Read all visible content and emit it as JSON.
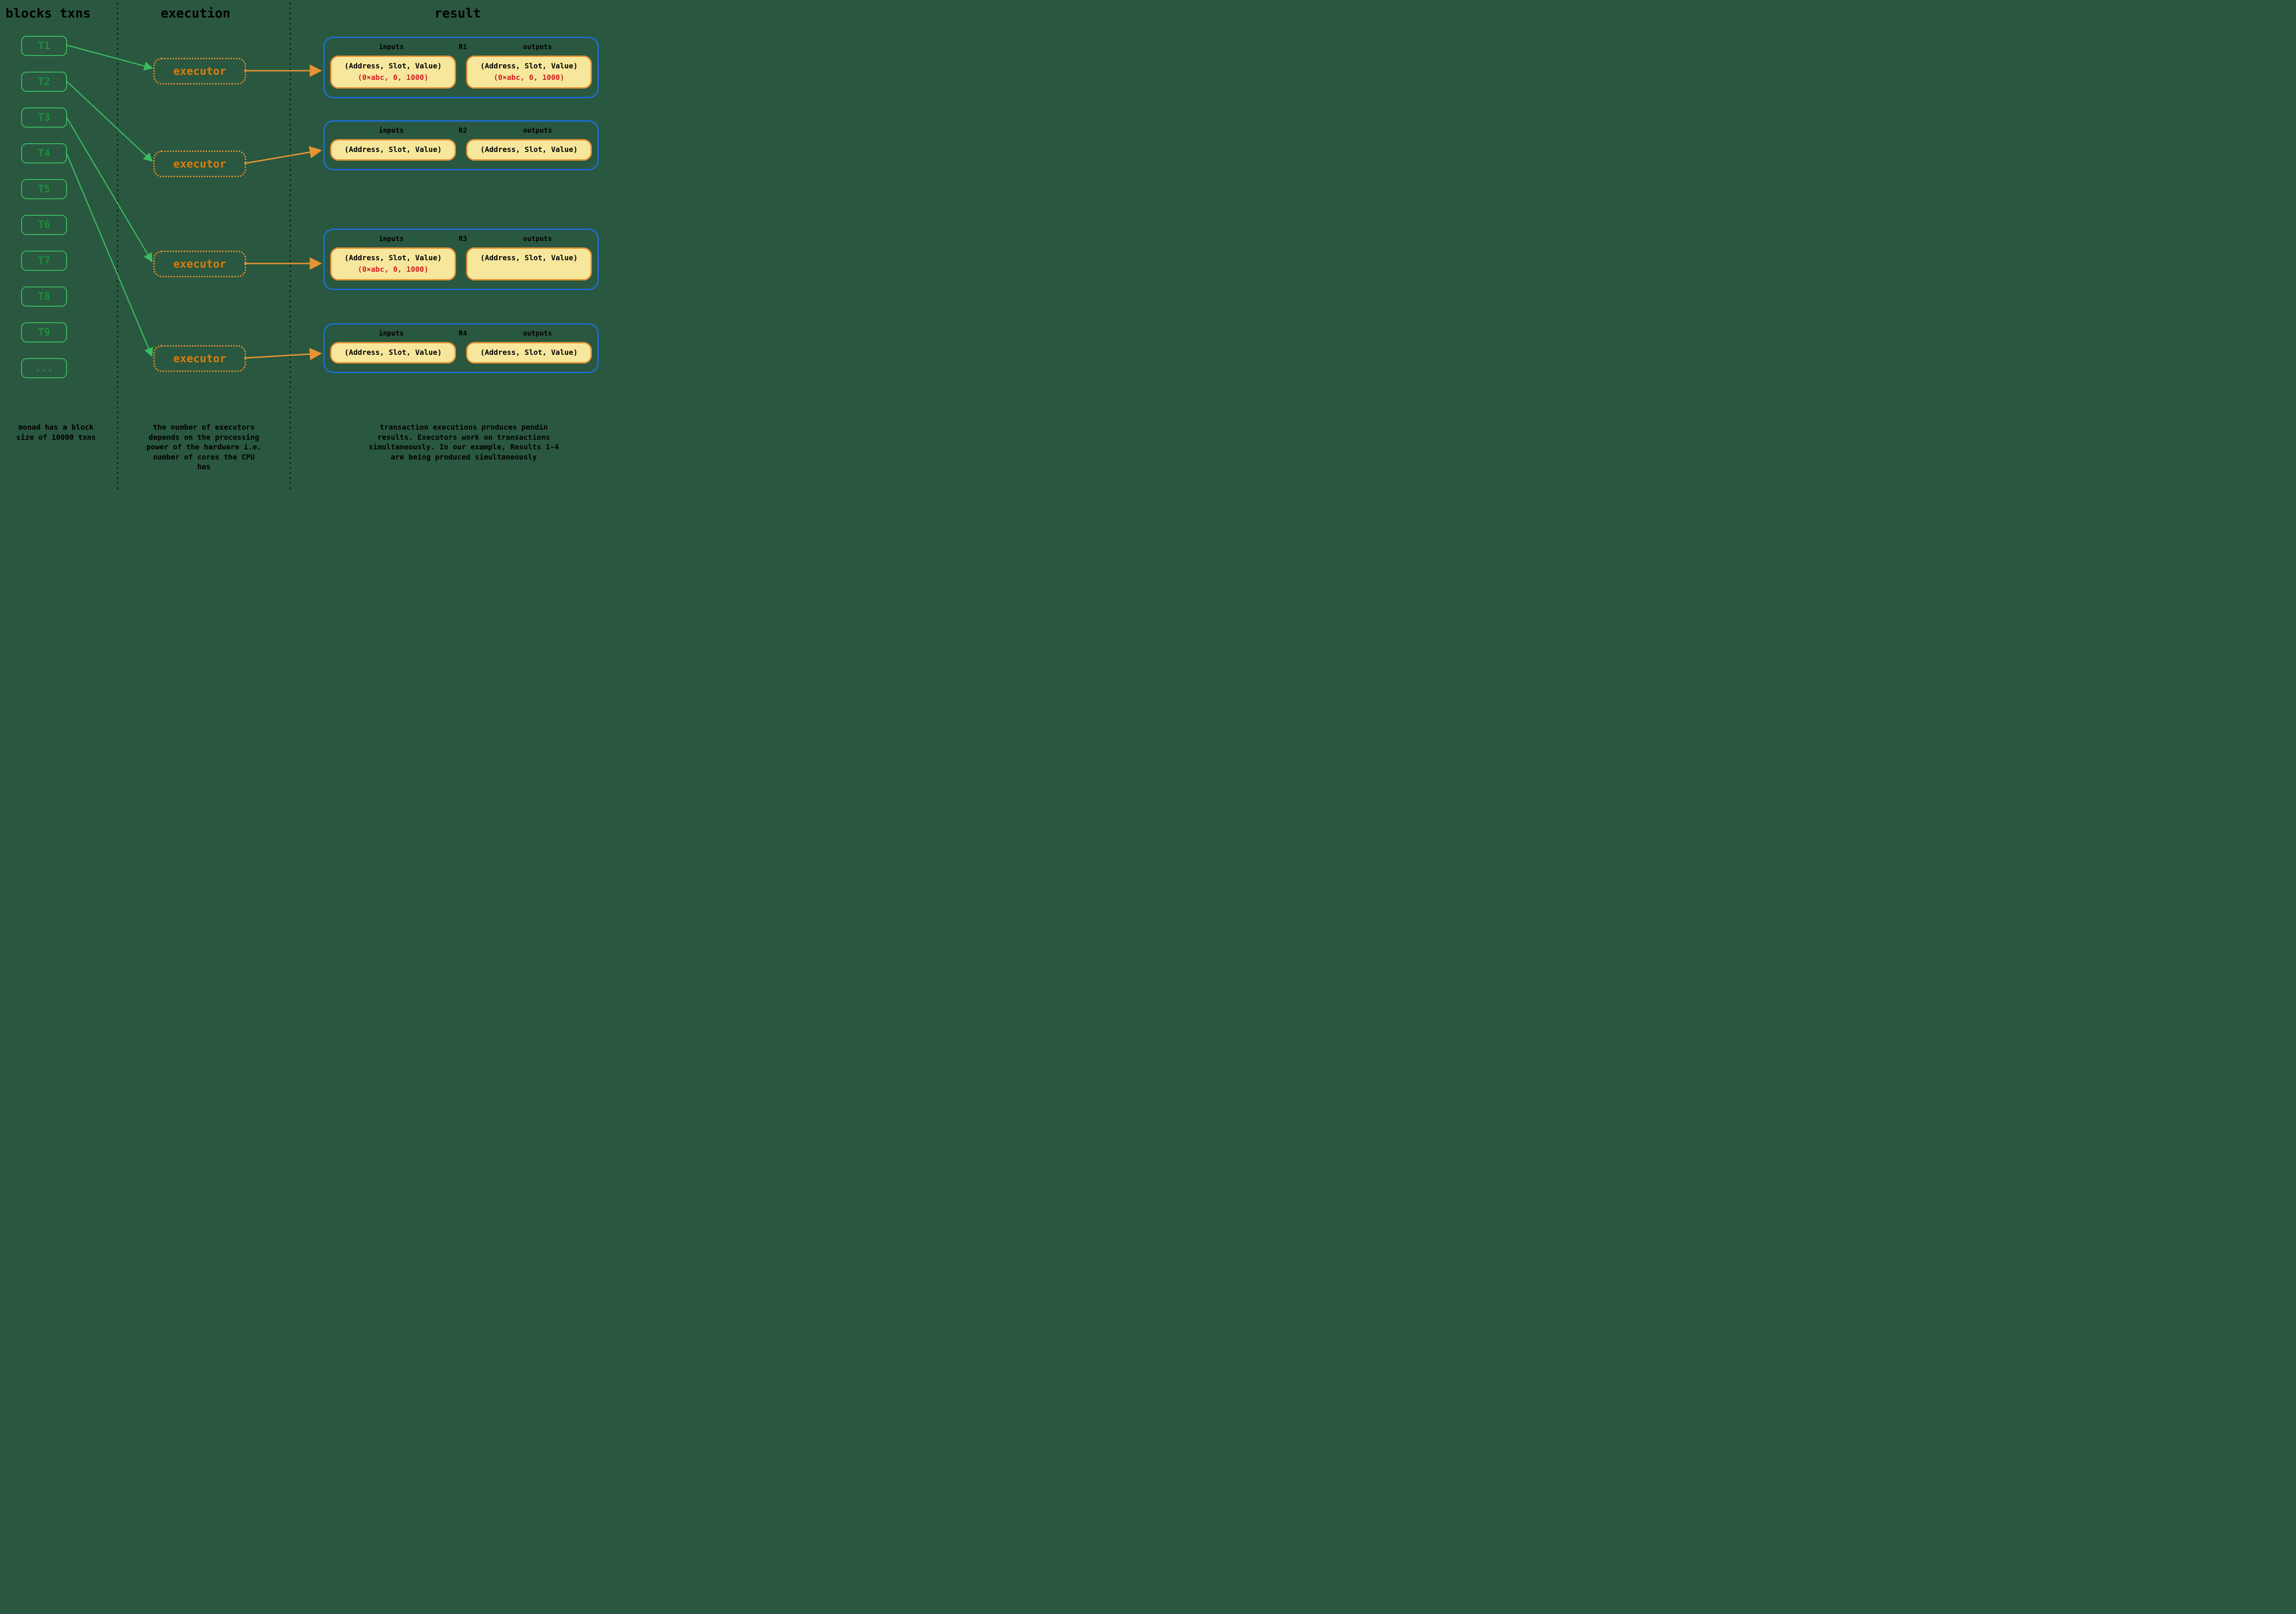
{
  "headers": {
    "col1": "blocks txns",
    "col2": "execution",
    "col3": "result"
  },
  "txns": [
    "T1",
    "T2",
    "T3",
    "T4",
    "T5",
    "T6",
    "T7",
    "T8",
    "T9",
    "..."
  ],
  "executor_label": "executor",
  "results": [
    {
      "id": "R1",
      "inputs_label": "inputs",
      "outputs_label": "outputs",
      "input_tuple": "(Address, Slot, Value)",
      "output_tuple": "(Address, Slot, Value)",
      "input_example": "(0×abc, 0, 1000)",
      "output_example": "(0×abc, 0, 1000)"
    },
    {
      "id": "R2",
      "inputs_label": "inputs",
      "outputs_label": "outputs",
      "input_tuple": "(Address, Slot, Value)",
      "output_tuple": "(Address, Slot, Value)"
    },
    {
      "id": "R3",
      "inputs_label": "inputs",
      "outputs_label": "outputs",
      "input_tuple": "(Address, Slot, Value)",
      "output_tuple": "(Address, Slot, Value)",
      "input_example": "(0×abc, 0, 1000)"
    },
    {
      "id": "R4",
      "inputs_label": "inputs",
      "outputs_label": "outputs",
      "input_tuple": "(Address, Slot, Value)",
      "output_tuple": "(Address, Slot, Value)"
    }
  ],
  "captions": {
    "txns": "monad has a block size of 10000 txns",
    "exec": "the number of executors depends on the processing power of the hardware i.e. number of cores the CPU has",
    "result": "transaction executions produces pendin results. Executors work on transactions simultaneously. In our example, Results 1-4 are being produced simultaneously"
  },
  "colors": {
    "bg": "#2a573f",
    "green": "#3bbb61",
    "orange": "#e79332",
    "blue": "#1d6fd6",
    "yellow": "#f6e79d",
    "red": "#d52020"
  }
}
